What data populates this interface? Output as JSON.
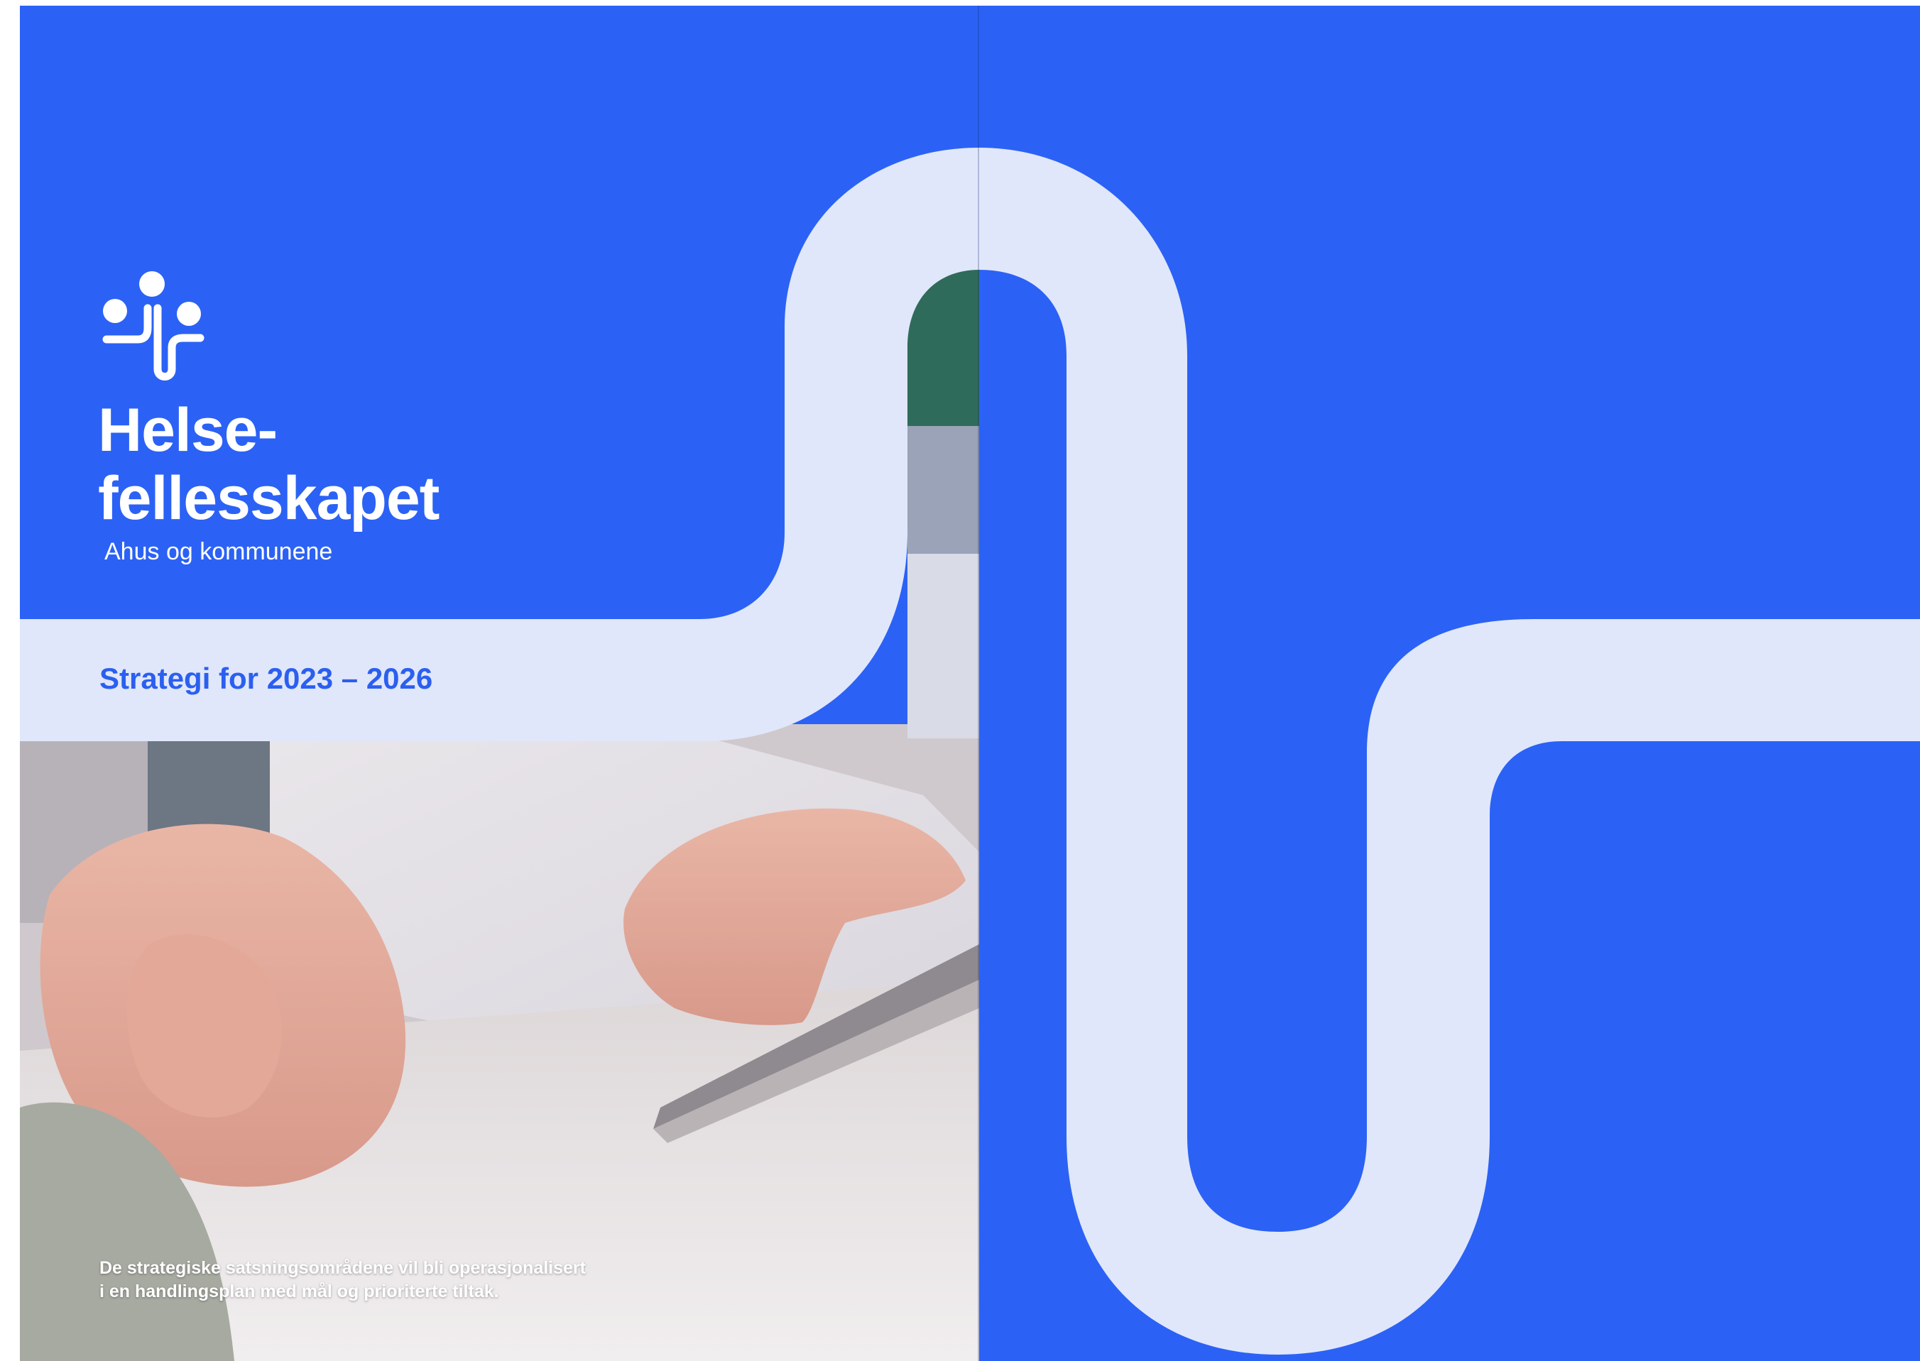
{
  "colors": {
    "brand_blue": "#2b62f5",
    "ribbon_light": "#e0e7fa",
    "heading_blue": "#2b5ff0",
    "text_white": "#ffffff"
  },
  "brand": {
    "logo_icon": "people-connected-icon",
    "title_line1": "Helse-",
    "title_line2": "fellesskapet",
    "subtitle": "Ahus og kommunene"
  },
  "cover": {
    "strategy_heading": "Strategi for 2023 – 2026",
    "photo_icon": "hands-with-tablet-photo"
  },
  "footer": {
    "note_line1": "De strategiske satsningsområdene vil bli operasjonalisert",
    "note_line2": "i en handlingsplan med mål og prioriterte tiltak."
  }
}
